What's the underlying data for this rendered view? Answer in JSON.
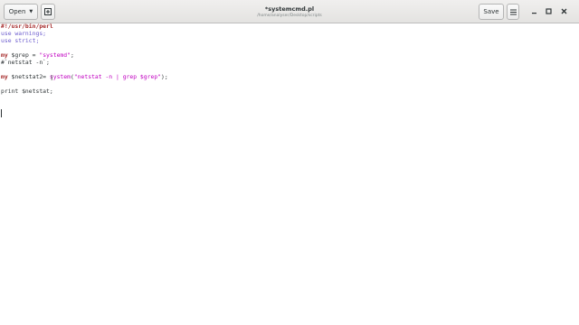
{
  "header": {
    "open_label": "Open",
    "title": "*systemcmd.pl",
    "subtitle": "/home/analyser/Desktop/scripts",
    "save_label": "Save"
  },
  "icons": {
    "open_arrow": "dropdown-arrow-icon",
    "new_tab": "new-document-icon",
    "menu": "hamburger-menu-icon",
    "minimize": "minimize-icon",
    "maximize": "maximize-icon",
    "close": "close-icon"
  },
  "code": {
    "l1": "#!/usr/bin/perl",
    "l2_kw": "use",
    "l2_rest": " warnings;",
    "l3_kw": "use",
    "l3_rest": " strict;",
    "l5_kw": "my",
    "l5_var": " $grep = ",
    "l5_str": "\"systemd\"",
    "l5_end": ";",
    "l6_comment": "#`netstat -n`;",
    "l8_kw": "my",
    "l8_var": " $netstat2= ",
    "l8_fn": "system",
    "l8_open": "(",
    "l8_str": "\"netstat -n | grep $grep\"",
    "l8_end": ");",
    "l10": "print $netstat;"
  },
  "colors": {
    "keyword": "#a52a2a",
    "string": "#c000c0",
    "text": "#2e3436"
  }
}
